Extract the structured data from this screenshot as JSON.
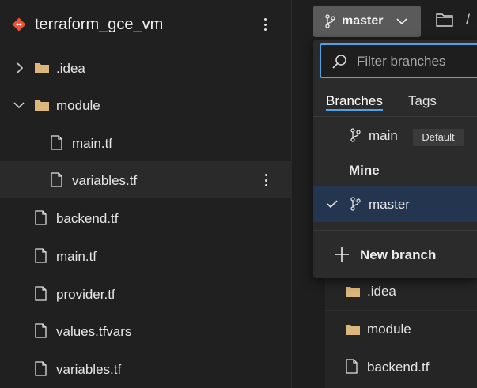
{
  "explorer": {
    "repo_name": "terraform_gce_vm",
    "tree": [
      {
        "label": ".idea",
        "kind": "folder",
        "expanded": false
      },
      {
        "label": "module",
        "kind": "folder",
        "expanded": true
      },
      {
        "label": "main.tf",
        "kind": "file"
      },
      {
        "label": "variables.tf",
        "kind": "file",
        "selected": true
      },
      {
        "label": "backend.tf",
        "kind": "file"
      },
      {
        "label": "main.tf",
        "kind": "file"
      },
      {
        "label": "provider.tf",
        "kind": "file"
      },
      {
        "label": "values.tfvars",
        "kind": "file"
      },
      {
        "label": "variables.tf",
        "kind": "file"
      }
    ]
  },
  "toolbar": {
    "branch_label": "master",
    "path_separator": "/"
  },
  "branch_dropdown": {
    "filter_placeholder": "Filter branches",
    "tabs": [
      "Branches",
      "Tags"
    ],
    "active_tab": "Branches",
    "default_branch": {
      "name": "main",
      "badge": "Default"
    },
    "mine_label": "Mine",
    "mine_branches": [
      {
        "name": "master",
        "selected": true
      }
    ],
    "new_branch_label": "New branch"
  },
  "content_list": [
    {
      "label": ".idea",
      "kind": "folder"
    },
    {
      "label": "module",
      "kind": "folder"
    },
    {
      "label": "backend.tf",
      "kind": "file"
    }
  ],
  "colors": {
    "accent": "#4ea3e6",
    "folder": "#dcb67a",
    "repo_logo": "#f05133",
    "selected_branch_bg": "#24364f"
  }
}
